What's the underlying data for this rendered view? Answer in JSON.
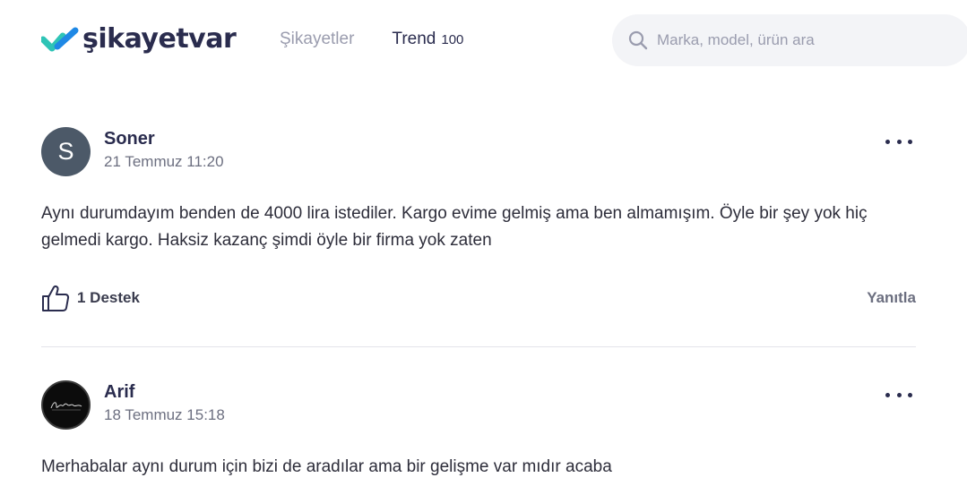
{
  "brand": {
    "name": "şikayetvar",
    "accent": "#2ec4b6",
    "dark": "#2a2c4e"
  },
  "nav": {
    "complaints_label": "Şikayetler",
    "trend_label": "Trend",
    "trend_count": "100"
  },
  "search": {
    "placeholder": "Marka, model, ürün ara",
    "icon": "search-icon"
  },
  "comments": [
    {
      "author": "Soner",
      "avatar_letter": "S",
      "date": "21 Temmuz 11:20",
      "text": "Aynı durumdayım benden de 4000 lira istediler. Kargo evime gelmiş ama ben almamışım. Öyle bir şey yok hiç gelmedi kargo. Haksiz kazanç şimdi öyle bir firma yok zaten",
      "support_label": "1 Destek",
      "reply_label": "Yanıtla"
    },
    {
      "author": "Arif",
      "avatar_letter": "",
      "date": "18 Temmuz 15:18",
      "text": "Merhabalar aynı durum için bizi de aradılar ama bir gelişme var mıdır acaba"
    }
  ]
}
